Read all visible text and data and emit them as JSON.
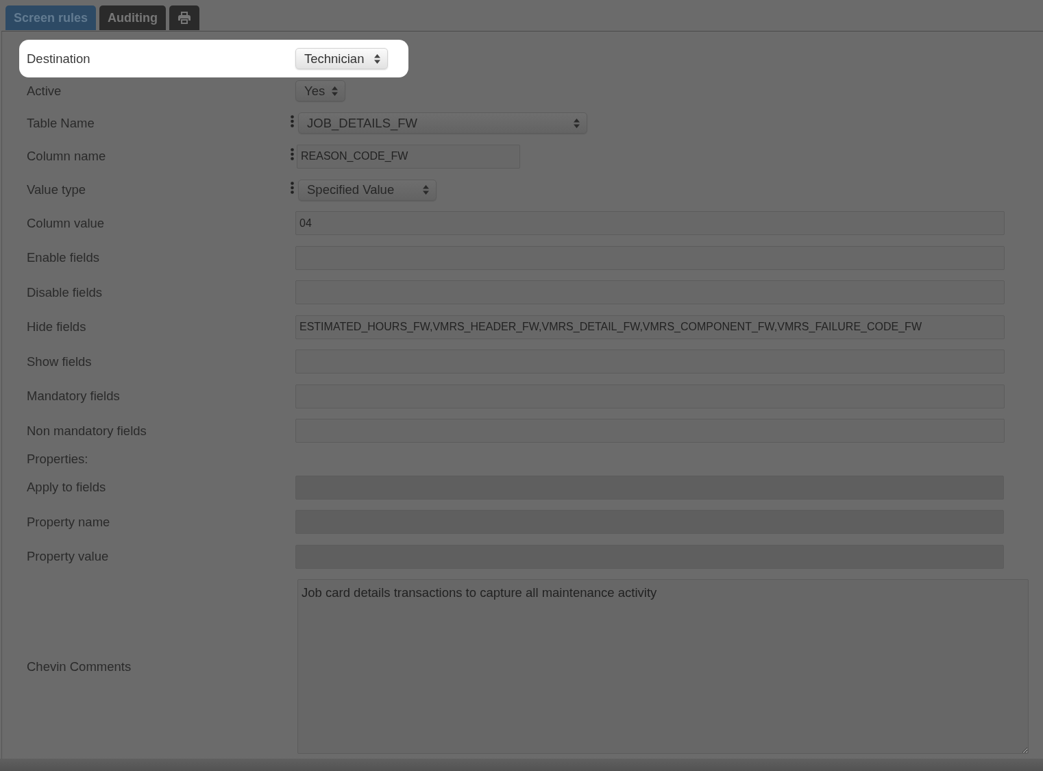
{
  "tabs": [
    {
      "kind": "text",
      "label": "Screen rules",
      "selected": true
    },
    {
      "kind": "text",
      "label": "Auditing",
      "selected": false
    },
    {
      "kind": "print",
      "selected": false
    }
  ],
  "fields": [
    {
      "kind": "select",
      "label": "Destination",
      "value": "Technician",
      "highlighted": true,
      "handle": false,
      "disabled": false
    },
    {
      "kind": "select",
      "label": "Active",
      "value": "Yes",
      "highlighted": false,
      "handle": false,
      "disabled": false
    },
    {
      "kind": "select",
      "label": "Table Name",
      "value": "JOB_DETAILS_FW",
      "highlighted": false,
      "handle": true,
      "disabled": false
    },
    {
      "kind": "text",
      "label": "Column name",
      "value": "REASON_CODE_FW",
      "highlighted": false,
      "handle": true,
      "disabled": false
    },
    {
      "kind": "select",
      "label": "Value type",
      "value": "Specified Value",
      "highlighted": false,
      "handle": true,
      "disabled": false
    },
    {
      "kind": "text",
      "label": "Column value",
      "value": "04",
      "highlighted": false,
      "handle": false,
      "disabled": false
    },
    {
      "kind": "text",
      "label": "Enable fields",
      "highlighted": false,
      "handle": false,
      "disabled": false
    },
    {
      "kind": "text",
      "label": "Disable fields",
      "highlighted": false,
      "handle": false,
      "disabled": false
    },
    {
      "kind": "text",
      "label": "Hide fields",
      "value": "ESTIMATED_HOURS_FW,VMRS_HEADER_FW,VMRS_DETAIL_FW,VMRS_COMPONENT_FW,VMRS_FAILURE_CODE_FW",
      "highlighted": false,
      "handle": false,
      "disabled": false
    },
    {
      "kind": "text",
      "label": "Show fields",
      "highlighted": false,
      "handle": false,
      "disabled": false
    },
    {
      "kind": "text",
      "label": "Mandatory fields",
      "highlighted": false,
      "handle": false,
      "disabled": false
    },
    {
      "kind": "text",
      "label": "Non mandatory fields",
      "highlighted": false,
      "handle": false,
      "disabled": false
    },
    {
      "kind": "heading",
      "label": "Properties:",
      "highlighted": false
    },
    {
      "kind": "text",
      "label": "Apply to fields",
      "highlighted": false,
      "handle": false,
      "disabled": true
    },
    {
      "kind": "text",
      "label": "Property name",
      "highlighted": false,
      "handle": false,
      "disabled": true
    },
    {
      "kind": "text",
      "label": "Property value",
      "highlighted": false,
      "handle": false,
      "disabled": true
    },
    {
      "kind": "textarea",
      "label": "Chevin Comments",
      "value": "Job card details transactions to capture all maintenance activity",
      "highlighted": false,
      "handle": false
    }
  ]
}
